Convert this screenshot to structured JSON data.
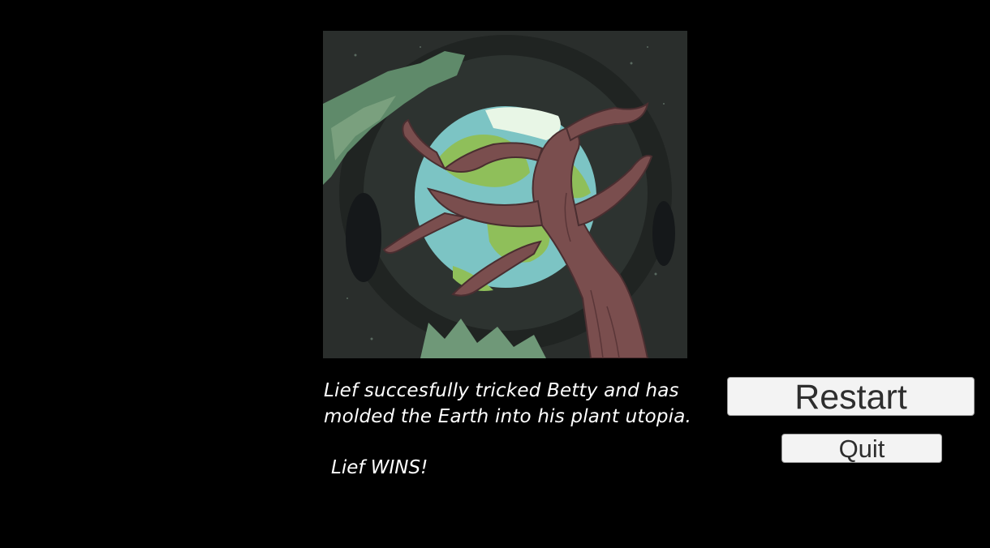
{
  "ending": {
    "story_line_1": "Lief succesfully tricked Betty and has",
    "story_line_2": "molded the Earth into his plant utopia.",
    "result": "Lief WINS!"
  },
  "buttons": {
    "restart_label": "Restart",
    "quit_label": "Quit"
  },
  "artwork": {
    "subject": "earth-gripped-by-tree-roots",
    "colors": {
      "space": "#2a2e2c",
      "ocean": "#7cc4c4",
      "land": "#8fbf5a",
      "roots": "#7a4e4e",
      "foliage": "#5f8a6a",
      "ice": "#e8f6e6"
    }
  }
}
